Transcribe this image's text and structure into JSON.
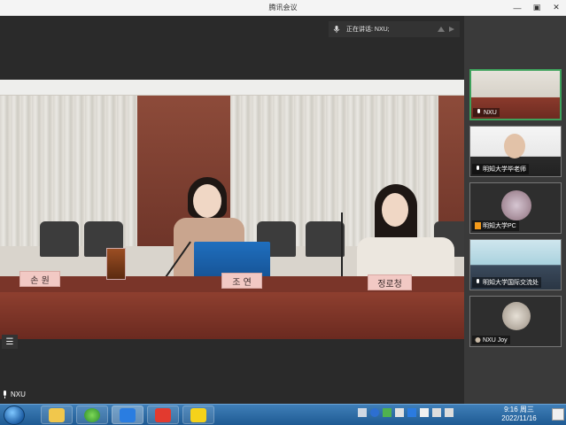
{
  "window": {
    "title": "腾讯会议"
  },
  "meeting": {
    "speaking_text": "正在讲话: NXU;",
    "current_user_label": "NXU"
  },
  "video": {
    "nameplates": [
      "손 원",
      "조 연",
      "정로청"
    ]
  },
  "sidebar": {
    "participants": [
      {
        "name": "NXU",
        "active": true
      },
      {
        "name": "明知大学毕老师",
        "active": false
      },
      {
        "name": "明知大学PC",
        "active": false
      },
      {
        "name": "明知大学国际交流处",
        "active": false
      },
      {
        "name": "NXU Joy",
        "active": false
      }
    ]
  },
  "taskbar": {
    "time": "9:16 周三",
    "date": "2022/11/16",
    "apps": [
      "file-explorer",
      "360-browser",
      "tencent-meeting",
      "wps-office",
      "player"
    ]
  },
  "colors": {
    "active_border": "#3ea25c",
    "taskbar": "#1f5a93"
  }
}
